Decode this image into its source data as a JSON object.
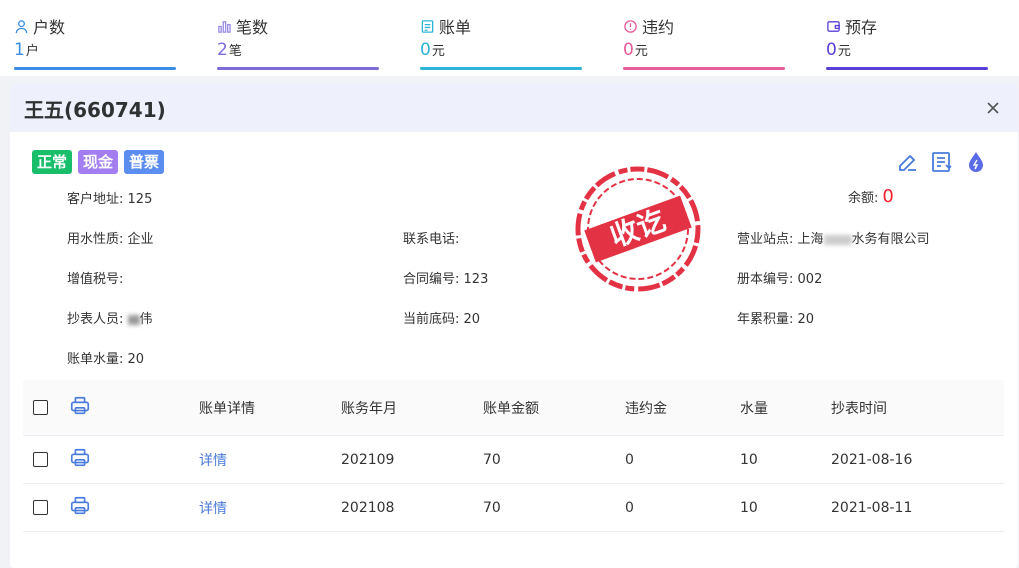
{
  "stats": [
    {
      "label": "户数",
      "value": "1",
      "unit": "户",
      "color": "#3a8ee6",
      "icon": "user-icon"
    },
    {
      "label": "笔数",
      "value": "2",
      "unit": "笔",
      "color": "#7b6cd9",
      "icon": "bar-chart-icon"
    },
    {
      "label": "账单",
      "value": "0",
      "unit": "元",
      "color": "#2cb5d8",
      "icon": "bill-icon"
    },
    {
      "label": "违约",
      "value": "0",
      "unit": "元",
      "color": "#e85c9a",
      "icon": "penalty-icon"
    },
    {
      "label": "预存",
      "value": "0",
      "unit": "元",
      "color": "#5b3fd9",
      "icon": "wallet-icon"
    }
  ],
  "panel": {
    "title": "王五(660741)",
    "tags": [
      {
        "label": "正常",
        "color": "#19be6b"
      },
      {
        "label": "现金",
        "color": "#a37ef0"
      },
      {
        "label": "普票",
        "color": "#5b8ef0"
      }
    ],
    "balance_label": "余额:",
    "balance_value": "0",
    "stamp_text": "收讫",
    "info": {
      "address_k": "客户地址:",
      "address_v": "125",
      "water_k": "用水性质:",
      "water_v": "企业",
      "phone_k": "联系电话:",
      "phone_v": "",
      "station_k": "营业站点:",
      "station_v_a": "上海",
      "station_v_b": "水务有限公司",
      "tax_k": "增值税号:",
      "tax_v": "",
      "contract_k": "合同编号:",
      "contract_v": "123",
      "book_k": "册本编号:",
      "book_v": "002",
      "reader_k": "抄表人员:",
      "reader_v": "伟",
      "meter_k": "当前底码:",
      "meter_v": "20",
      "annual_k": "年累积量:",
      "annual_v": "20",
      "billwater_k": "账单水量:",
      "billwater_v": "20"
    }
  },
  "table": {
    "headers": [
      "账单详情",
      "账务年月",
      "账单金额",
      "违约金",
      "水量",
      "抄表时间"
    ],
    "rows": [
      {
        "detail": "详情",
        "month": "202109",
        "amount": "70",
        "penalty": "0",
        "water": "10",
        "time": "2021-08-16"
      },
      {
        "detail": "详情",
        "month": "202108",
        "amount": "70",
        "penalty": "0",
        "water": "10",
        "time": "2021-08-11"
      }
    ]
  },
  "colors": {
    "accent": "#4a7bdc",
    "danger": "#f5222d",
    "stamp": "#e0162b"
  }
}
